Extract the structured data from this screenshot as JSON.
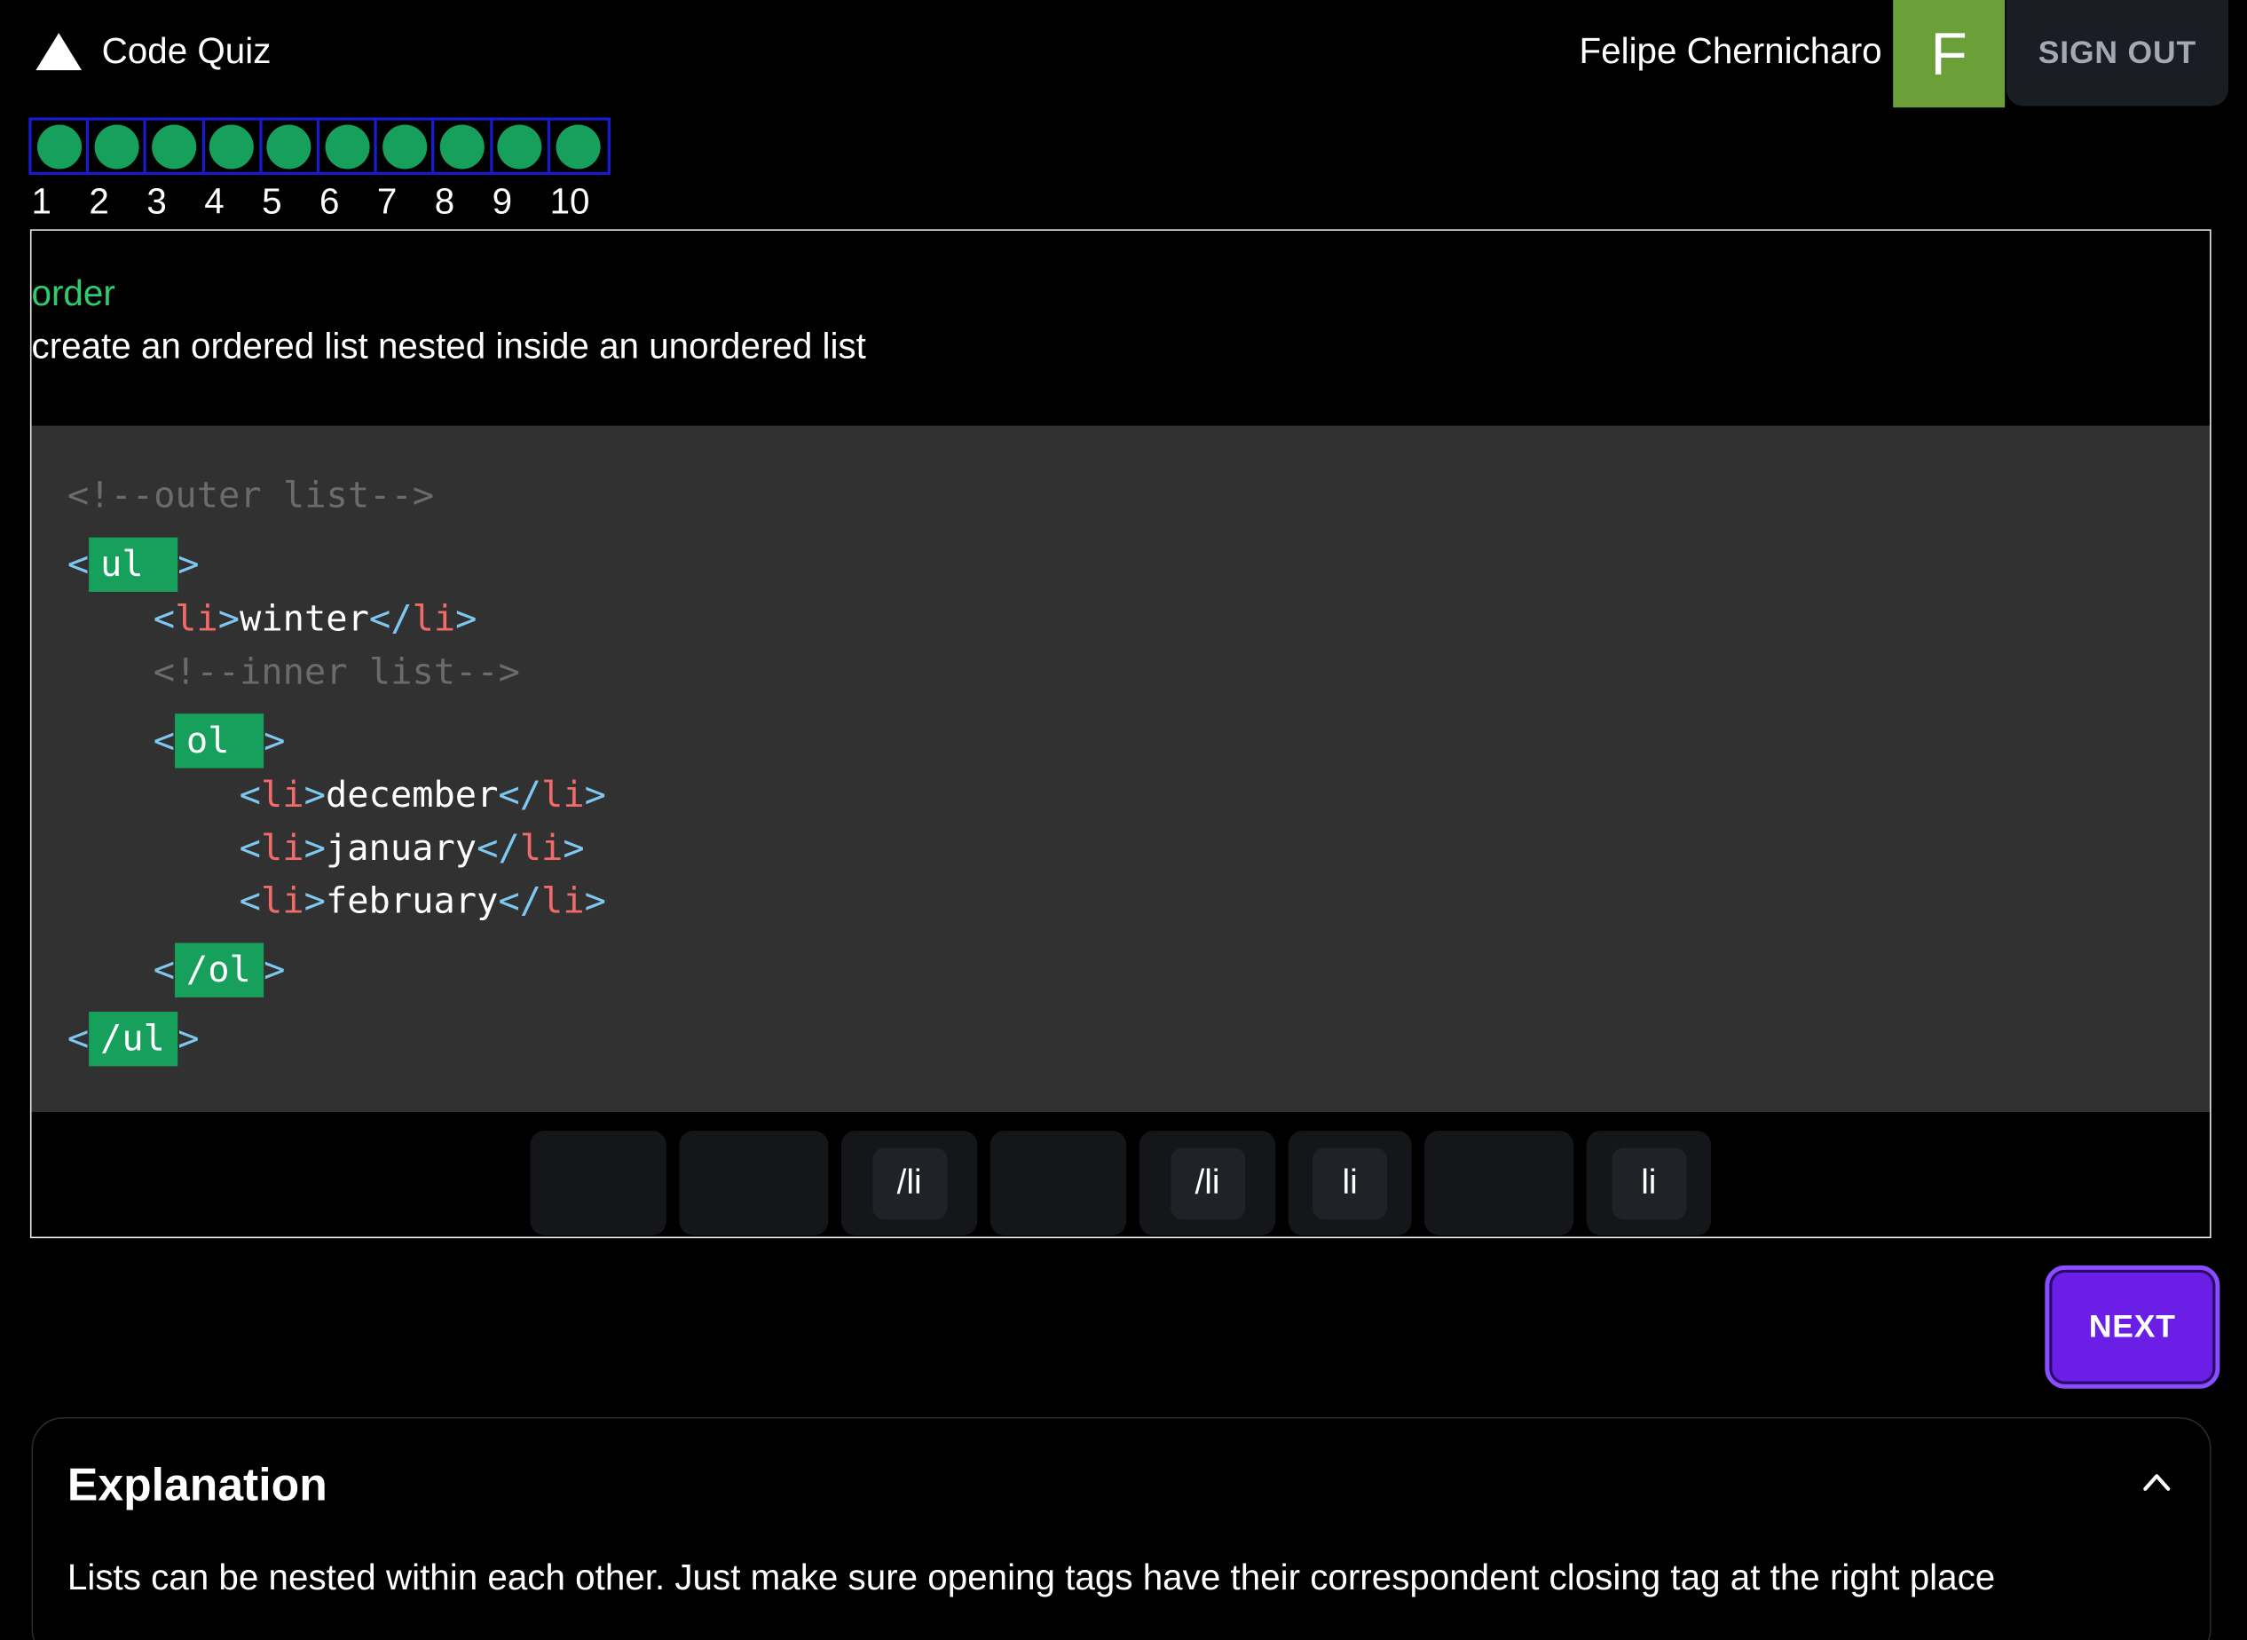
{
  "header": {
    "app_title": "Code Quiz",
    "user_name": "Felipe Chernicharo",
    "avatar_initial": "F",
    "signout_label": "SIGN OUT",
    "logo_icon": "triangle-logo-icon"
  },
  "progress": {
    "steps": [
      "1",
      "2",
      "3",
      "4",
      "5",
      "6",
      "7",
      "8",
      "9",
      "10"
    ],
    "completed_count": 10,
    "dot_color": "#16a05b"
  },
  "question": {
    "category": "order",
    "prompt": "create an ordered list nested inside an unordered list"
  },
  "code": {
    "comment_outer": "<!--outer list-->",
    "comment_inner": "<!--inner list-->",
    "slot_ul_open": "ul",
    "slot_ol_open": "ol",
    "slot_ol_close": "/ol",
    "slot_ul_close": "/ul",
    "item_winter": "winter",
    "item_december": "december",
    "item_january": "january",
    "item_february": "february",
    "li_tag": "li",
    "li_close_tag": "/li"
  },
  "options": [
    {
      "label": ""
    },
    {
      "label": ""
    },
    {
      "label": "/li"
    },
    {
      "label": ""
    },
    {
      "label": "/li"
    },
    {
      "label": "li"
    },
    {
      "label": ""
    },
    {
      "label": "li"
    }
  ],
  "actions": {
    "next_label": "NEXT"
  },
  "explanation": {
    "title": "Explanation",
    "text": "Lists can be nested within each other. Just make sure opening tags have their correspondent closing tag at the right place"
  },
  "colors": {
    "accent_green": "#16a05b",
    "category_green": "#2ecc71",
    "next_purple": "#6a1ee6",
    "avatar_green": "#6aa037"
  }
}
